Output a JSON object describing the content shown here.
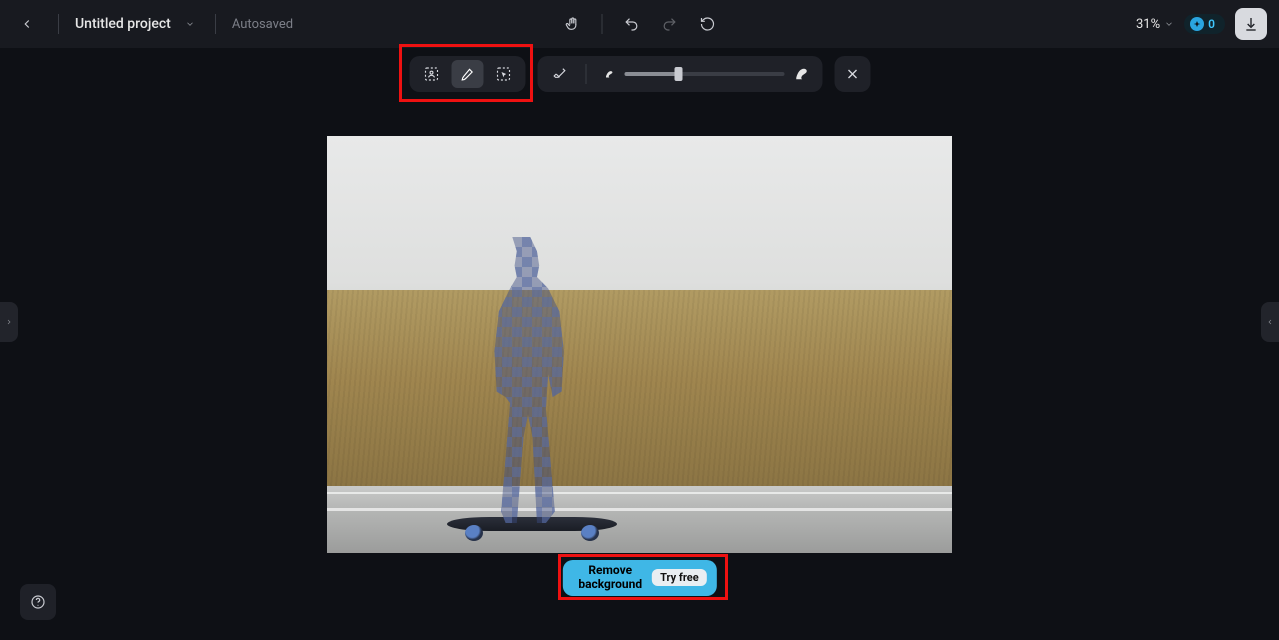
{
  "header": {
    "project_title": "Untitled project",
    "autosave": "Autosaved",
    "zoom": "31%",
    "credits": "0"
  },
  "toolbar": {
    "mode_subject": "subject",
    "mode_brush": "brush",
    "mode_lasso": "lasso",
    "mode_eraser": "eraser"
  },
  "remove_bg": {
    "line1": "Remove",
    "line2": "background",
    "try": "Try free"
  }
}
